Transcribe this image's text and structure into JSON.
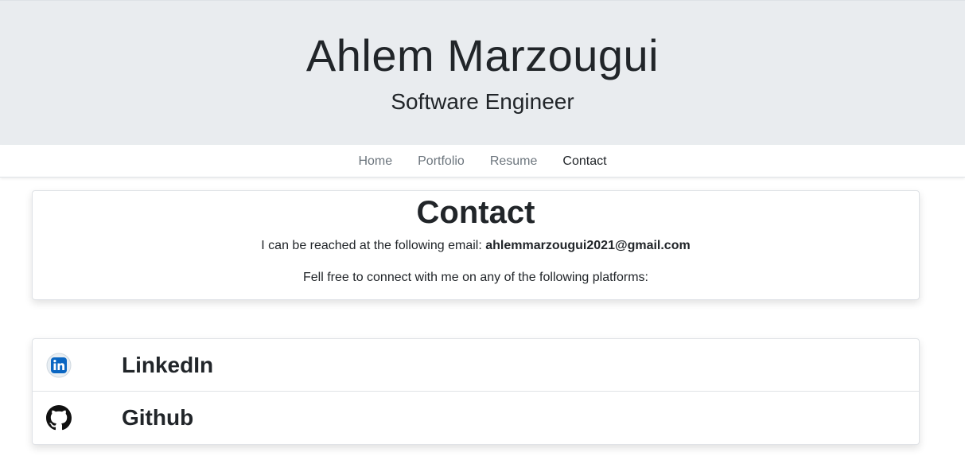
{
  "header": {
    "name": "Ahlem Marzougui",
    "role": "Software Engineer"
  },
  "nav": {
    "items": [
      {
        "label": "Home",
        "active": false
      },
      {
        "label": "Portfolio",
        "active": false
      },
      {
        "label": "Resume",
        "active": false
      },
      {
        "label": "Contact",
        "active": true
      }
    ]
  },
  "contact": {
    "title": "Contact",
    "email_intro": "I can be reached at the following email:",
    "email": "ahlemmarzougui2021@gmail.com",
    "platforms_text": "Fell free to connect with me on any of the following platforms:"
  },
  "links": [
    {
      "label": "LinkedIn",
      "icon": "linkedin-icon"
    },
    {
      "label": "Github",
      "icon": "github-icon"
    }
  ],
  "colors": {
    "header_bg": "#e9ecef",
    "nav_text": "#6c757d",
    "nav_active": "#212529",
    "linkedin_blue": "#0a66c2"
  }
}
